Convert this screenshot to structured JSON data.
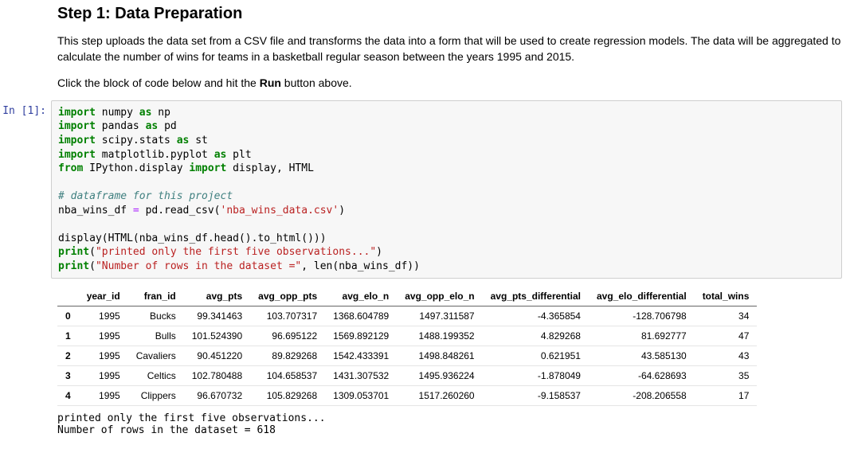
{
  "markdown": {
    "heading": "Step 1: Data Preparation",
    "p1": "This step uploads the data set from a CSV file and transforms the data into a form that will be used to create regression models. The data will be aggregated to calculate the number of wins for teams in a basketball regular season between the years 1995 and 2015.",
    "p2_pre": "Click the block of code below and hit the ",
    "p2_bold": "Run",
    "p2_post": " button above."
  },
  "prompt": "In [1]:",
  "code": {
    "l1a": "import",
    "l1b": " numpy ",
    "l1c": "as",
    "l1d": " np",
    "l2a": "import",
    "l2b": " pandas ",
    "l2c": "as",
    "l2d": " pd",
    "l3a": "import",
    "l3b": " scipy.stats ",
    "l3c": "as",
    "l3d": " st",
    "l4a": "import",
    "l4b": " matplotlib.pyplot ",
    "l4c": "as",
    "l4d": " plt",
    "l5a": "from",
    "l5b": " IPython.display ",
    "l5c": "import",
    "l5d": " display, HTML",
    "l6": "",
    "l7": "# dataframe for this project",
    "l8a": "nba_wins_df ",
    "l8b": "=",
    "l8c": " pd.read_csv(",
    "l8d": "'nba_wins_data.csv'",
    "l8e": ")",
    "l9": "",
    "l10": "display(HTML(nba_wins_df.head().to_html()))",
    "l11a": "print",
    "l11b": "(",
    "l11c": "\"printed only the first five observations...\"",
    "l11d": ")",
    "l12a": "print",
    "l12b": "(",
    "l12c": "\"Number of rows in the dataset =\"",
    "l12d": ", len(nba_wins_df))"
  },
  "table": {
    "columns": [
      "year_id",
      "fran_id",
      "avg_pts",
      "avg_opp_pts",
      "avg_elo_n",
      "avg_opp_elo_n",
      "avg_pts_differential",
      "avg_elo_differential",
      "total_wins"
    ],
    "rows": [
      {
        "idx": "0",
        "cells": [
          "1995",
          "Bucks",
          "99.341463",
          "103.707317",
          "1368.604789",
          "1497.311587",
          "-4.365854",
          "-128.706798",
          "34"
        ]
      },
      {
        "idx": "1",
        "cells": [
          "1995",
          "Bulls",
          "101.524390",
          "96.695122",
          "1569.892129",
          "1488.199352",
          "4.829268",
          "81.692777",
          "47"
        ]
      },
      {
        "idx": "2",
        "cells": [
          "1995",
          "Cavaliers",
          "90.451220",
          "89.829268",
          "1542.433391",
          "1498.848261",
          "0.621951",
          "43.585130",
          "43"
        ]
      },
      {
        "idx": "3",
        "cells": [
          "1995",
          "Celtics",
          "102.780488",
          "104.658537",
          "1431.307532",
          "1495.936224",
          "-1.878049",
          "-64.628693",
          "35"
        ]
      },
      {
        "idx": "4",
        "cells": [
          "1995",
          "Clippers",
          "96.670732",
          "105.829268",
          "1309.053701",
          "1517.260260",
          "-9.158537",
          "-208.206558",
          "17"
        ]
      }
    ]
  },
  "stdout": {
    "line1": "printed only the first five observations...",
    "line2": "Number of rows in the dataset = 618"
  }
}
